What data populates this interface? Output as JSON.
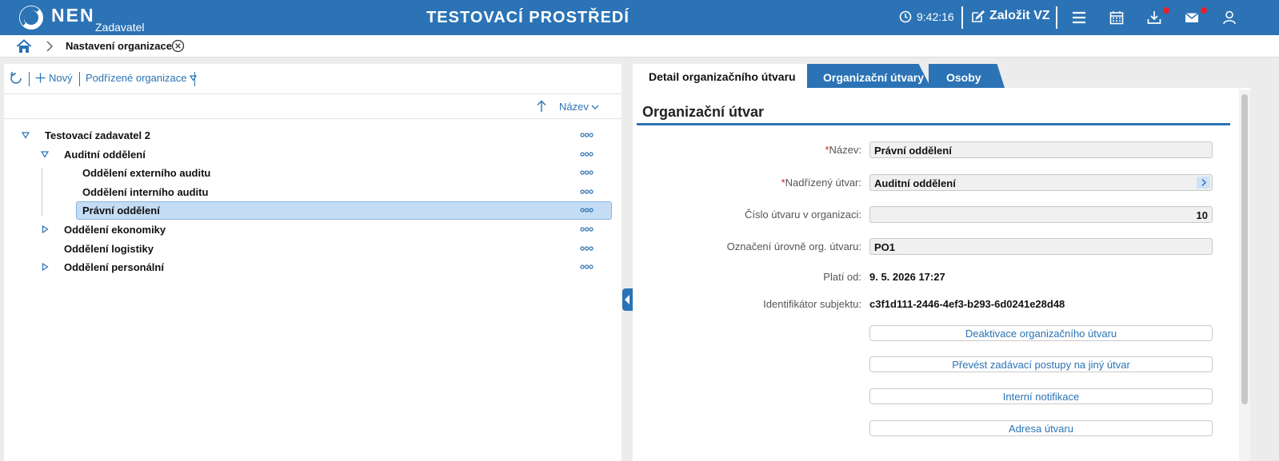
{
  "header": {
    "logo_text": "NEN",
    "logo_sub": "Zadavatel",
    "environment_title": "TESTOVACÍ PROSTŘEDÍ",
    "clock": "9:42:16",
    "create_label": "Založit VZ",
    "icons": [
      "clock-icon",
      "edit-icon",
      "menu-icon",
      "calendar-icon",
      "download-icon",
      "mail-icon",
      "user-icon"
    ],
    "notification_color": "#e8202a"
  },
  "breadcrumb": {
    "current": "Nastavení organizace"
  },
  "left_panel": {
    "toolbar": {
      "new_label": "Nový",
      "sub_org_label": "Podřízené organizace"
    },
    "sort_label": "Název",
    "tree": [
      {
        "label": "Testovací zadavatel 2",
        "level": 0,
        "expander": "expanded"
      },
      {
        "label": "Auditní oddělení",
        "level": 1,
        "expander": "expanded"
      },
      {
        "label": "Oddělení externího auditu",
        "level": 2,
        "expander": "none"
      },
      {
        "label": "Oddělení interního auditu",
        "level": 2,
        "expander": "none"
      },
      {
        "label": "Právní oddělení",
        "level": 2,
        "expander": "none",
        "selected": true
      },
      {
        "label": "Oddělení ekonomiky",
        "level": 1,
        "expander": "collapsed"
      },
      {
        "label": "Oddělení logistiky",
        "level": 1,
        "expander": "none"
      },
      {
        "label": "Oddělení personální",
        "level": 1,
        "expander": "collapsed"
      }
    ]
  },
  "right_panel": {
    "tabs": [
      "Detail organizačního útvaru",
      "Organizační útvary",
      "Osoby"
    ],
    "active_tab": 0,
    "section_title": "Organizační útvar",
    "fields": {
      "name_label": "Název:",
      "name_value": "Právní oddělení",
      "parent_label": "Nadřízený útvar:",
      "parent_value": "Auditní oddělení",
      "number_label": "Číslo útvaru v organizaci:",
      "number_value": "10",
      "level_label": "Označení úrovně org. útvaru:",
      "level_value": "PO1",
      "valid_from_label": "Platí od:",
      "valid_from_value": "9. 5. 2026 17:27",
      "subject_id_label": "Identifikátor subjektu:",
      "subject_id_value": "c3f1d111-2446-4ef3-b293-6d0241e28d48"
    },
    "actions": [
      "Deaktivace organizačního útvaru",
      "Převést zadávací postupy na jiný útvar",
      "Interní notifikace",
      "Adresa útvaru"
    ]
  },
  "colors": {
    "accent": "#2b73b5",
    "selection": "#c4dcf4",
    "required": "#d32222"
  }
}
